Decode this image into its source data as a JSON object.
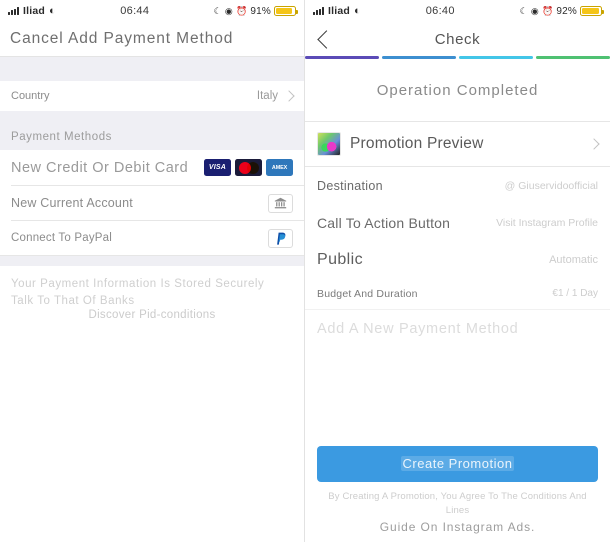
{
  "left": {
    "status": {
      "carrier": "Iliad",
      "time": "06:44",
      "battery_pct": "91%",
      "wifi_icon": "wifi-icon",
      "signal_icon": "signal-bars-icon",
      "moon_icon": "do-not-disturb-icon",
      "lock_icon": "rotation-lock-icon",
      "alarm_icon": "alarm-icon",
      "battery_icon": "battery-low-power-icon"
    },
    "nav": {
      "title": "Cancel Add Payment Method"
    },
    "country_row": {
      "label": "Country",
      "value": "Italy",
      "chevron_icon": "chevron-right-icon"
    },
    "section_header": "Payment Methods",
    "methods": [
      {
        "label": "New Credit Or Debit Card",
        "kind": "cards",
        "brands": [
          {
            "name": "visa-icon",
            "text": "VISA"
          },
          {
            "name": "mastercard-icon",
            "text": ""
          },
          {
            "name": "amex-icon",
            "text": "AMEX"
          }
        ]
      },
      {
        "label": "New Current Account",
        "kind": "bank",
        "icon": "bank-icon"
      },
      {
        "label": "Connect To PayPal",
        "kind": "paypal",
        "icon": "paypal-icon"
      }
    ],
    "note": {
      "line1": "Your Payment Information Is Stored Securely",
      "line2": "Talk To That Of Banks",
      "link": "Discover Pid-conditions"
    }
  },
  "right": {
    "status": {
      "carrier": "Iliad",
      "time": "06:40",
      "battery_pct": "92%",
      "wifi_icon": "wifi-icon",
      "signal_icon": "signal-bars-icon",
      "moon_icon": "do-not-disturb-icon",
      "lock_icon": "rotation-lock-icon",
      "alarm_icon": "alarm-icon",
      "battery_icon": "battery-low-power-icon"
    },
    "nav": {
      "title": "Check",
      "back_icon": "back-chevron-icon"
    },
    "progress": {
      "segments": [
        "#5b4bb7",
        "#3d8fd0",
        "#43c6e8",
        "#4fc172"
      ]
    },
    "operation_completed": "Operation Completed",
    "preview": {
      "title": "Promotion Preview",
      "thumb_icon": "promotion-thumbnail",
      "chevron_icon": "chevron-right-icon"
    },
    "details": [
      {
        "label": "Destination",
        "value": "@ Giuservidoofficial"
      },
      {
        "label": "Call To Action Button",
        "value": "Visit Instagram Profile"
      },
      {
        "label": "Public",
        "value": "Automatic"
      },
      {
        "label": "Budget And Duration",
        "value": "€1 / 1 Day"
      }
    ],
    "add_method": "Add A New Payment Method",
    "cta": {
      "label": "Create Promotion",
      "color": "#3b9ae1"
    },
    "footer": {
      "line1": "By Creating A Promotion, You Agree To The Conditions And Lines",
      "line2": "Guide On Instagram Ads."
    }
  }
}
